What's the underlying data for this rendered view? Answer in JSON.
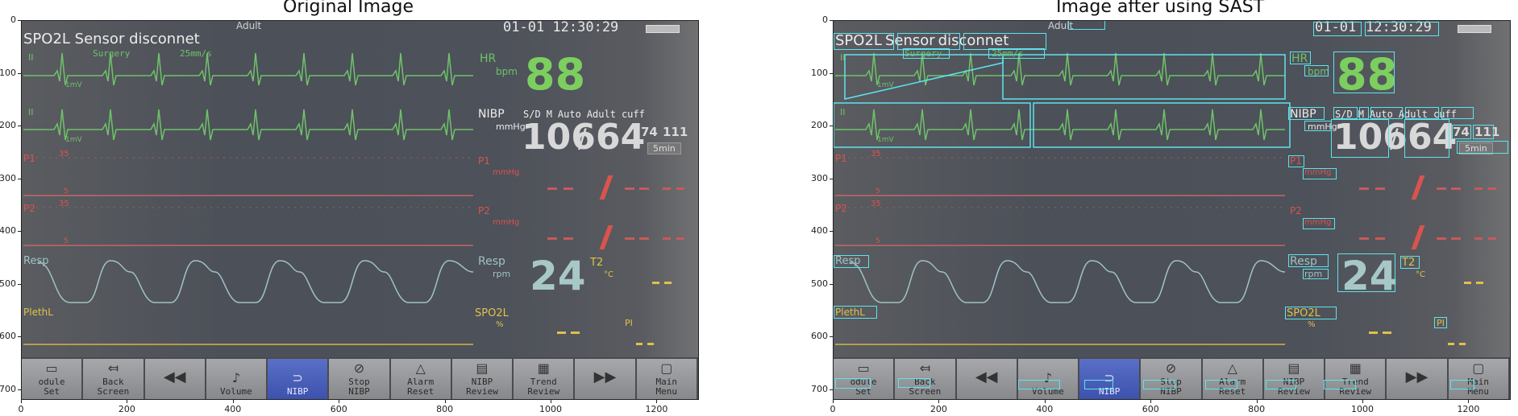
{
  "titles": {
    "left": "Original Image",
    "right": "Image after using SAST"
  },
  "axes": {
    "y_ticks": [
      "0",
      "100",
      "200",
      "300",
      "400",
      "500",
      "600",
      "700"
    ],
    "x_ticks": [
      "0",
      "200",
      "400",
      "600",
      "800",
      "1000",
      "1200"
    ]
  },
  "monitor": {
    "top": {
      "mode": "Adult",
      "datetime": "01-01 12:30:29",
      "date": "01-01",
      "time": "12:30:29"
    },
    "alarm": "SPO2L Sensor disconnet",
    "alarm_words": [
      "SPO2L",
      "Sensor",
      "disconnet"
    ],
    "ecg1": {
      "lead": "II",
      "mode": "Surgery",
      "speed": "25mm/s",
      "scale": "1mV",
      "scale2": "1mV"
    },
    "hr": {
      "label": "HR",
      "unit": "bpm",
      "value": "88"
    },
    "nibp": {
      "label": "NIBP",
      "unit": "mmHg",
      "mode_words": [
        "S/D",
        "M",
        "Auto",
        "Adult",
        "cuff"
      ],
      "sys": "106",
      "sep": "/",
      "dia": "64",
      "mean": "74",
      "extra": "111",
      "interval": "5min"
    },
    "p1": {
      "label": "P1",
      "unit": "mmHg",
      "scale": "35",
      "base": "5"
    },
    "p2": {
      "label": "P2",
      "unit": "mmHg",
      "scale": "35",
      "base": "5"
    },
    "resp": {
      "label": "Resp",
      "unit": "rpm",
      "value": "24"
    },
    "t2": {
      "label": "T2",
      "unit": "°C"
    },
    "pleth": {
      "label": "PlethL"
    },
    "spo2": {
      "label": "SPO2L",
      "unit": "%"
    },
    "pi": {
      "label": "PI"
    },
    "buttons": [
      {
        "l1": "odule",
        "l2": "Set",
        "icon": "▭"
      },
      {
        "l1": "Back",
        "l2": "Screen",
        "icon": "⤆"
      },
      {
        "l1": "",
        "l2": "",
        "icon": "◀◀"
      },
      {
        "l1": "",
        "l2": "Volume",
        "icon": "♪"
      },
      {
        "l1": "",
        "l2": "NIBP",
        "icon": "⊃"
      },
      {
        "l1": "Stop",
        "l2": "NIBP",
        "icon": "⊘"
      },
      {
        "l1": "Alarm",
        "l2": "Reset",
        "icon": "△"
      },
      {
        "l1": "NIBP",
        "l2": "Review",
        "icon": "▤"
      },
      {
        "l1": "Trend",
        "l2": "Review",
        "icon": "▦"
      },
      {
        "l1": "",
        "l2": "",
        "icon": "▶▶"
      },
      {
        "l1": "Main",
        "l2": "Menu",
        "icon": "▢"
      }
    ]
  },
  "colors": {
    "ecg": "#6fc26a",
    "pressure": "#d9534f",
    "resp": "#9fc2c4",
    "pleth": "#e0c24a",
    "detection": "#5fe3ee"
  }
}
